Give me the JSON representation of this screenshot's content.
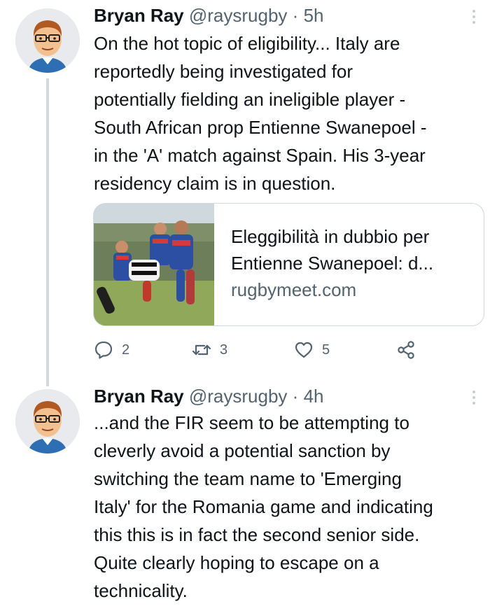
{
  "tweets": [
    {
      "author_name": "Bryan Ray",
      "author_handle": "@raysrugby",
      "separator": "·",
      "time": "5h",
      "text": "On the hot topic of eligibility... Italy are\nreportedly being investigated for\npotentially fielding an ineligible player -\nSouth African prop Entienne Swanepoel -\nin the 'A' match against Spain. His 3-year\nresidency claim is in question.",
      "card": {
        "title": "Eleggibilità in dubbio per",
        "title_line2": "Entienne Swanepoel: d...",
        "domain": "rugbymeet.com"
      },
      "actions": {
        "replies": "2",
        "retweets": "3",
        "likes": "5"
      }
    },
    {
      "author_name": "Bryan Ray",
      "author_handle": "@raysrugby",
      "separator": "·",
      "time": "4h",
      "text": "...and the FIR seem to be attempting to\ncleverly avoid a potential sanction by\nswitching the team name to 'Emerging\nItaly' for the Romania game and indicating\nthis this is in fact the second senior side.\nQuite clearly hoping to escape on a\ntechnicality."
    }
  ],
  "icons": {
    "reply": "reply-icon",
    "retweet": "retweet-icon",
    "like": "heart-icon",
    "share": "share-icon",
    "more": "more-icon"
  },
  "colors": {
    "text": "#0f1419",
    "secondary": "#536471",
    "border": "#cfd9de",
    "thread_line": "#cfd9de"
  }
}
